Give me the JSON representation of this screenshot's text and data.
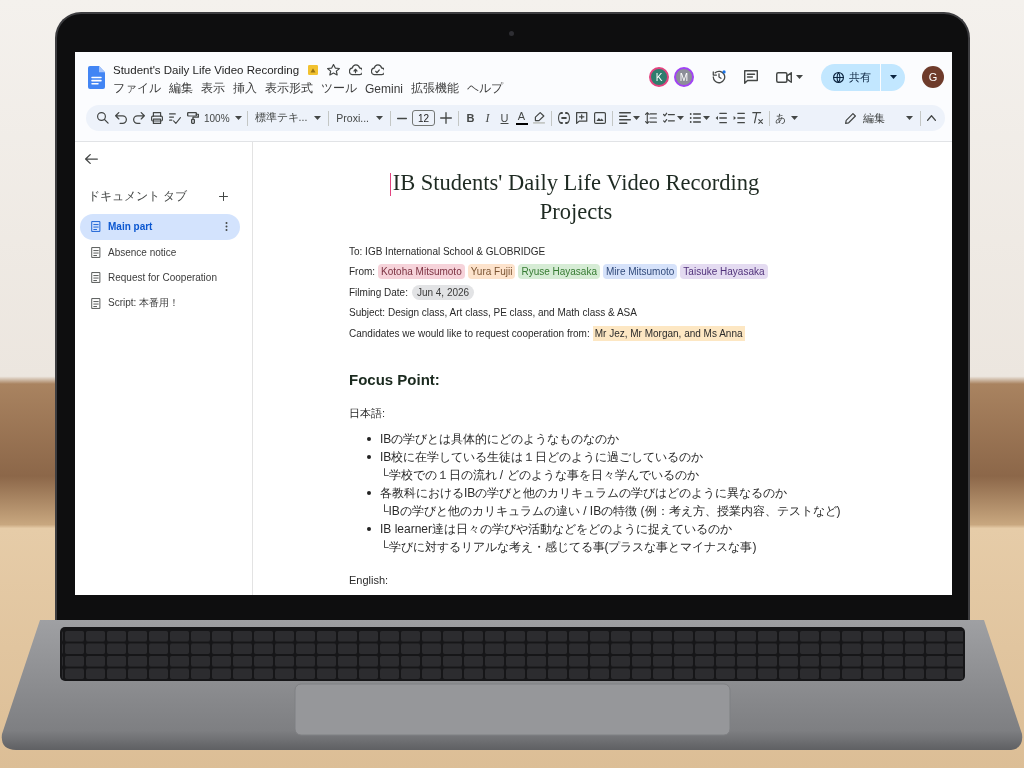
{
  "app": {
    "document_name": "Student's Daily Life Video Recording",
    "menu": [
      "ファイル",
      "編集",
      "表示",
      "挿入",
      "表示形式",
      "ツール",
      "Gemini",
      "拡張機能",
      "ヘルプ"
    ],
    "collaborators": [
      {
        "initial": "K",
        "color": "#2f7d6d",
        "ring": {
          "color": "#e2437f"
        }
      },
      {
        "initial": "M",
        "color": "#8c8e99",
        "ring": {
          "color": "#a142f4"
        }
      }
    ],
    "share": {
      "label": "共有"
    },
    "account": {
      "initial": "G"
    }
  },
  "toolbar": {
    "zoom": "100%",
    "paragraph_style": "標準テキ...",
    "font": "Proxi...",
    "font_size": "12",
    "bold": "B",
    "italic": "I",
    "underline": "U",
    "text_color": "A",
    "input_tools": "あ",
    "mode": "編集"
  },
  "sidebar": {
    "heading": "ドキュメント タブ",
    "tabs": [
      {
        "label": "Main part",
        "selected": true
      },
      {
        "label": "Absence notice",
        "selected": false
      },
      {
        "label": "Request for Cooperation",
        "selected": false
      },
      {
        "label": "Script: 本番用！",
        "selected": false
      }
    ]
  },
  "document": {
    "title": "IB Students' Daily Life Video Recording Projects",
    "details": [
      {
        "kind": "text",
        "text": "To: IGB International School & GLOBRIDGE"
      },
      {
        "kind": "people",
        "label": "From:",
        "people": [
          {
            "name": "Kotoha Mitsumoto",
            "color": "#f6d3da"
          },
          {
            "name": "Yura Fujii",
            "color": "#fde3cc"
          },
          {
            "name": "Ryuse Hayasaka",
            "color": "#d6ecd5"
          },
          {
            "name": "Mire Mitsumoto",
            "color": "#d6e2fa"
          },
          {
            "name": "Taisuke Hayasaka",
            "color": "#e4dbf1"
          }
        ]
      },
      {
        "kind": "date",
        "label": "Filming Date:",
        "value": "Jun 4, 2026"
      },
      {
        "kind": "text",
        "text": "Subject: Design class, Art class, PE class, and Math class & ASA"
      },
      {
        "kind": "highlight",
        "label": "Candidates we would like to request cooperation from:",
        "value": "Mr Jez, Mr Morgan, and Ms Anna"
      }
    ],
    "heading": "Focus Point:",
    "sections": [
      {
        "label": "日本語:",
        "items": [
          {
            "text": "IBの学びとは具体的にどのようなものなのか"
          },
          {
            "text": "IB校に在学している生徒は１日どのように過ごしているのか",
            "note": "└学校での１日の流れ / どのような事を日々学んでいるのか"
          },
          {
            "text": "各教科におけるIBの学びと他のカリキュラムの学びはどのように異なるのか",
            "note": "└IBの学びと他のカリキュラムの違い / IBの特徴 (例：考え方、授業内容、テストなど)"
          },
          {
            "text": "IB learner達は日々の学びや活動などをどのように捉えているのか",
            "note": "└学びに対するリアルな考え・感じてる事(プラスな事とマイナスな事)"
          }
        ]
      },
      {
        "label": "English:"
      }
    ]
  }
}
